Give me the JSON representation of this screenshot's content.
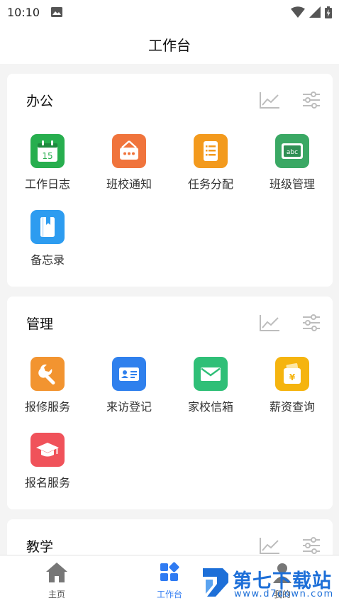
{
  "status_bar": {
    "time": "10:10"
  },
  "header": {
    "title": "工作台"
  },
  "sections": [
    {
      "title": "办公",
      "items": [
        {
          "label": "工作日志",
          "icon": "calendar-icon",
          "color": "#27ae4e",
          "day": "15"
        },
        {
          "label": "班校通知",
          "icon": "notice-board-icon",
          "color": "#f0743c"
        },
        {
          "label": "任务分配",
          "icon": "task-list-icon",
          "color": "#f39a1d"
        },
        {
          "label": "班级管理",
          "icon": "chalkboard-icon",
          "color": "#3aa864",
          "board_text": "abc"
        },
        {
          "label": "备忘录",
          "icon": "notebook-icon",
          "color": "#2d9cf0"
        }
      ]
    },
    {
      "title": "管理",
      "items": [
        {
          "label": "报修服务",
          "icon": "wrench-icon",
          "color": "#f29430"
        },
        {
          "label": "来访登记",
          "icon": "id-card-icon",
          "color": "#2f80ed"
        },
        {
          "label": "家校信箱",
          "icon": "mail-icon",
          "color": "#2fbf77"
        },
        {
          "label": "薪资查询",
          "icon": "wallet-icon",
          "color": "#f5b40f",
          "currency": "¥"
        },
        {
          "label": "报名服务",
          "icon": "graduation-cap-icon",
          "color": "#f0525a"
        }
      ]
    },
    {
      "title": "教学"
    }
  ],
  "tabbar": {
    "tabs": [
      {
        "label": "主页",
        "icon": "home-icon"
      },
      {
        "label": "工作台",
        "icon": "workbench-icon",
        "active": true
      },
      {
        "label": "我的",
        "icon": "profile-icon"
      }
    ]
  },
  "watermark": {
    "brand": "第七下载站",
    "url": "www.d7down.com",
    "color": "#1d6fd8"
  },
  "colors": {
    "accent": "#2f7bf2",
    "toolbar_icon": "#bdbdbd"
  }
}
